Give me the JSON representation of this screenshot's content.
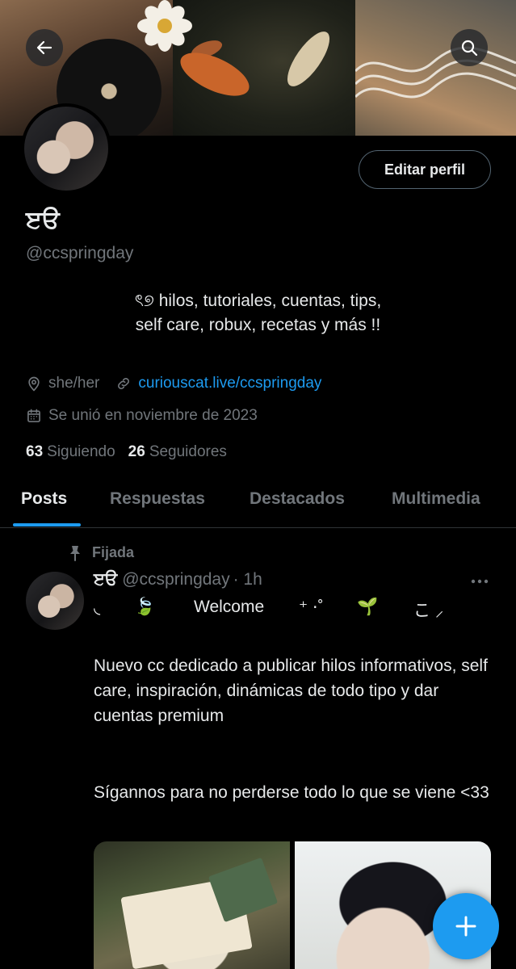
{
  "header": {
    "back_icon": "arrow-left-icon",
    "search_icon": "search-icon"
  },
  "profile": {
    "edit_label": "Editar perfil",
    "display_name": "ੲੳ",
    "handle": "@ccspringday",
    "bio_line1": "ৎ୭ hilos, tutoriales, cuentas, tips,",
    "bio_line2": "self care, robux, recetas y más !!",
    "pronouns": "she/her",
    "website": "curiouscat.live/ccspringday",
    "joined": "Se unió en noviembre de 2023",
    "following_count": "63",
    "following_label": "Siguiendo",
    "followers_count": "26",
    "followers_label": "Seguidores"
  },
  "tabs": [
    {
      "label": "Posts",
      "active": true
    },
    {
      "label": "Respuestas",
      "active": false
    },
    {
      "label": "Destacados",
      "active": false
    },
    {
      "label": "Multimedia",
      "active": false
    }
  ],
  "post": {
    "pinned_label": "Fijada",
    "author_name": "ੲੳ",
    "author_handle": "@ccspringday",
    "time": "· 1h",
    "welcome": {
      "part1": "◟",
      "part2": "🍃",
      "part3": "Welcome",
      "part4": "⁺  ⋅˚",
      "part5": "🌱",
      "part6": "こ ⸝"
    },
    "text_paragraph1": "Nuevo cc dedicado a publicar hilos informativos, self care, inspiración, dinámicas de todo tipo y dar cuentas premium",
    "text_paragraph2": "Sígannos para no perderse todo lo que se viene <33"
  },
  "colors": {
    "background": "#000000",
    "text": "#e7e9ea",
    "muted": "#71767b",
    "accent": "#1d9bf0",
    "border": "#2f3336"
  },
  "fab_icon": "plus-icon"
}
